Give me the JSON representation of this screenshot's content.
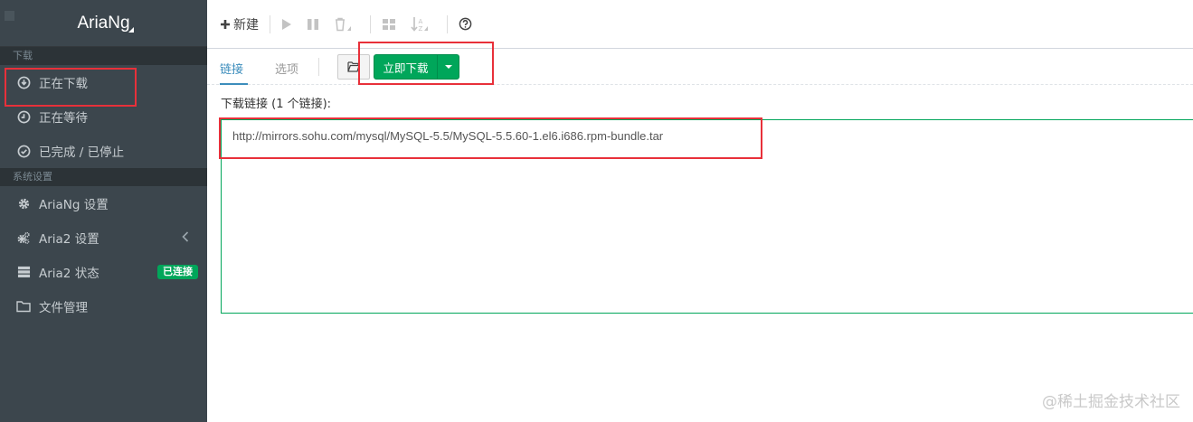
{
  "app": {
    "title": "AriaNg"
  },
  "sidebar": {
    "sections": [
      {
        "header": "下载",
        "items": [
          {
            "label": "正在下载",
            "icon": "download-circle-icon"
          },
          {
            "label": "正在等待",
            "icon": "clock-icon"
          },
          {
            "label": "已完成 / 已停止",
            "icon": "check-circle-icon"
          }
        ]
      },
      {
        "header": "系统设置",
        "items": [
          {
            "label": "AriaNg 设置",
            "icon": "gear-icon"
          },
          {
            "label": "Aria2 设置",
            "icon": "gears-icon"
          },
          {
            "label": "Aria2 状态",
            "icon": "server-icon",
            "badge": "已连接"
          },
          {
            "label": "文件管理",
            "icon": "folder-icon"
          }
        ]
      }
    ]
  },
  "toolbar": {
    "new_label": "新建"
  },
  "tabs": {
    "link": "链接",
    "options": "选项"
  },
  "actions": {
    "download_now": "立即下载"
  },
  "form": {
    "url_label": "下载链接 (1 个链接):",
    "url_value": "http://mirrors.sohu.com/mysql/MySQL-5.5/MySQL-5.5.60-1.el6.i686.rpm-bundle.tar"
  },
  "watermark": "@稀土掘金技术社区",
  "colors": {
    "sidebar_bg": "#3c464d",
    "accent_green": "#00a65a",
    "accent_blue": "#3c8dbc",
    "highlight_red": "#e8303a"
  }
}
